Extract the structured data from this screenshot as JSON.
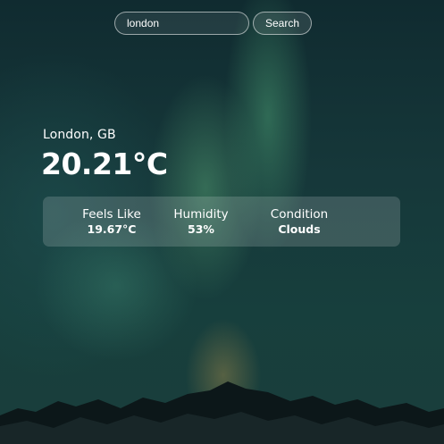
{
  "search": {
    "value": "london",
    "placeholder": "",
    "button_label": "Search"
  },
  "weather": {
    "location": "London, GB",
    "temperature": "20.21°C",
    "details": [
      {
        "label": "Feels Like",
        "value": "19.67°C"
      },
      {
        "label": "Humidity",
        "value": "53%"
      },
      {
        "label": "Condition",
        "value": "Clouds"
      }
    ]
  },
  "colors": {
    "text": "#ffffff",
    "background_top": "#102b30",
    "aurora": "#46966e"
  }
}
